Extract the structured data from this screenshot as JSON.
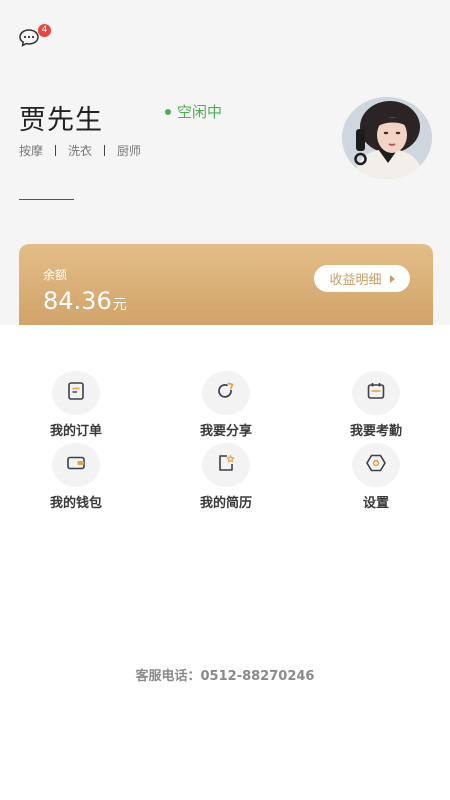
{
  "header": {
    "message_badge": "4"
  },
  "profile": {
    "name": "贾先生",
    "status": "空闲中",
    "skills": [
      "按摩",
      "洗衣",
      "厨师"
    ]
  },
  "balance": {
    "label": "余额",
    "amount": "84.36",
    "unit": "元",
    "detail_button": "收益明细"
  },
  "menu": {
    "items": [
      {
        "label": "我的订单",
        "icon": "order-icon"
      },
      {
        "label": "我要分享",
        "icon": "share-icon"
      },
      {
        "label": "我要考勤",
        "icon": "calendar-icon"
      },
      {
        "label": "我的钱包",
        "icon": "wallet-icon"
      },
      {
        "label": "我的简历",
        "icon": "resume-icon"
      },
      {
        "label": "设置",
        "icon": "settings-icon"
      }
    ]
  },
  "footer": {
    "service_phone": "客服电话：0512-88270246"
  },
  "colors": {
    "accent_gold": "#d1a46a",
    "status_green": "#4caf50",
    "icon_dark": "#3b3f4a",
    "icon_accent": "#e8a33c",
    "badge_red": "#e8453c"
  }
}
